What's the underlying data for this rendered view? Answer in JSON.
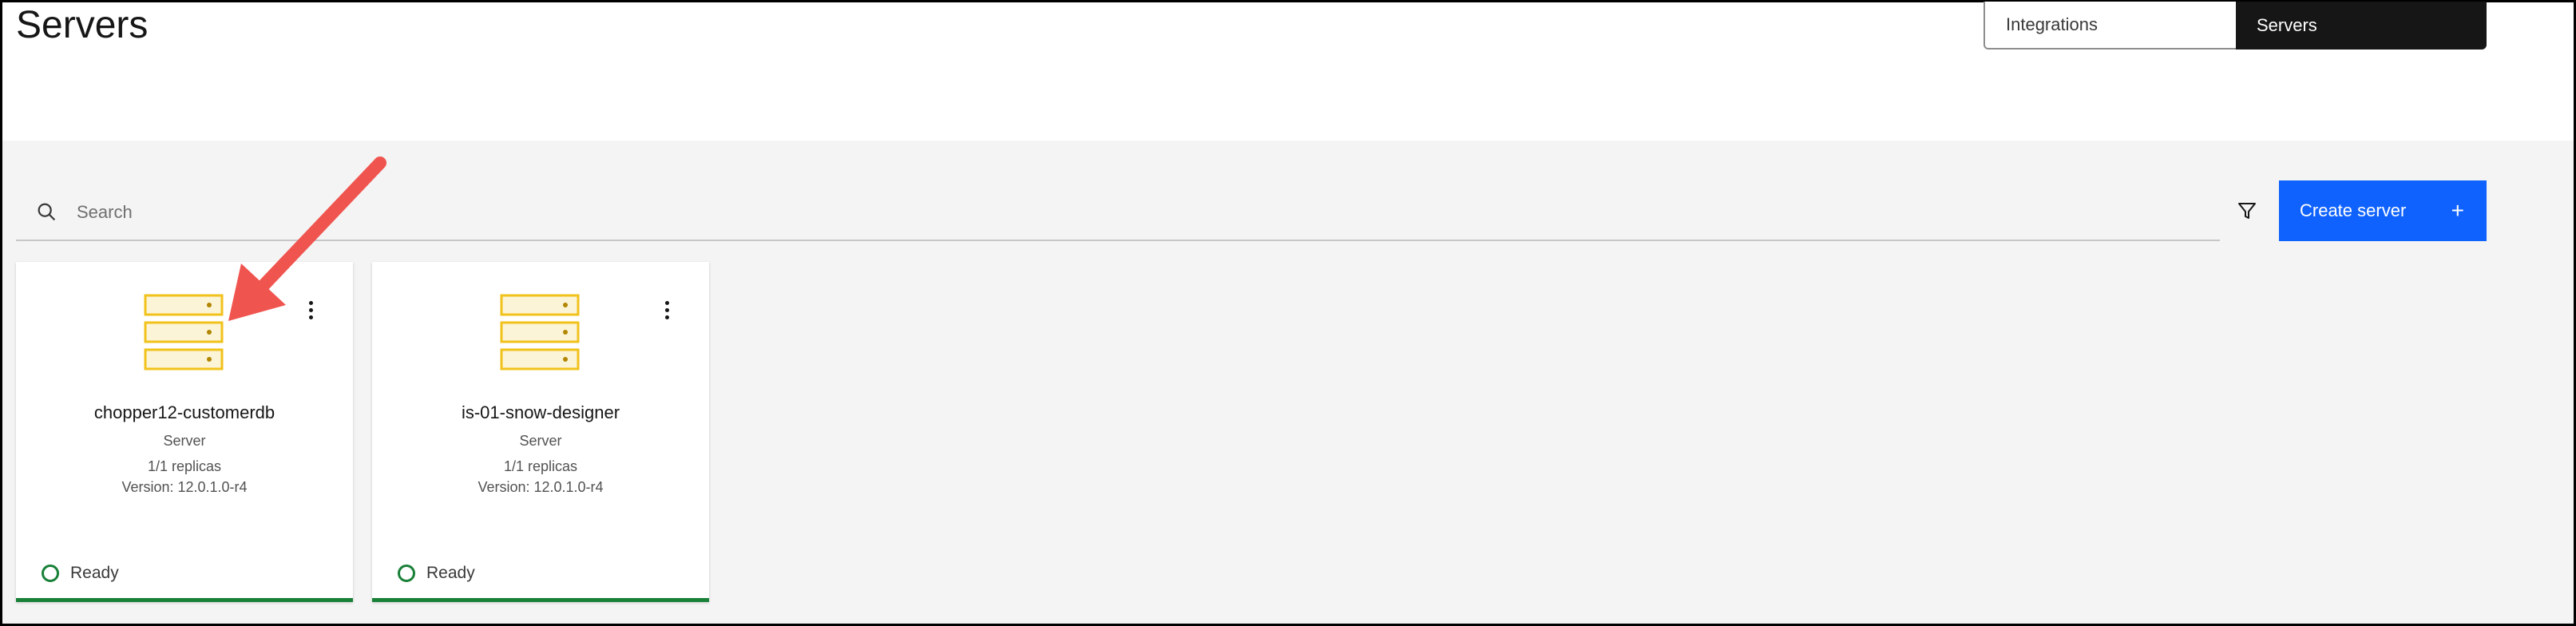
{
  "page": {
    "title": "Servers"
  },
  "view_toggle": {
    "integrations_label": "Integrations",
    "servers_label": "Servers",
    "active": "Servers"
  },
  "search": {
    "placeholder": "Search"
  },
  "toolbar": {
    "create_label": "Create server",
    "create_icon": "plus-icon",
    "filter_icon": "filter-icon"
  },
  "colors": {
    "primary": "#0f62fe",
    "ready": "#198038",
    "server_icon": "#f1c21b",
    "annotation_arrow": "#f0544f"
  },
  "servers": [
    {
      "name": "chopper12-customerdb",
      "type": "Server",
      "replicas": "1/1 replicas",
      "version": "Version: 12.0.1.0-r4",
      "status": "Ready"
    },
    {
      "name": "is-01-snow-designer",
      "type": "Server",
      "replicas": "1/1 replicas",
      "version": "Version: 12.0.1.0-r4",
      "status": "Ready"
    }
  ]
}
